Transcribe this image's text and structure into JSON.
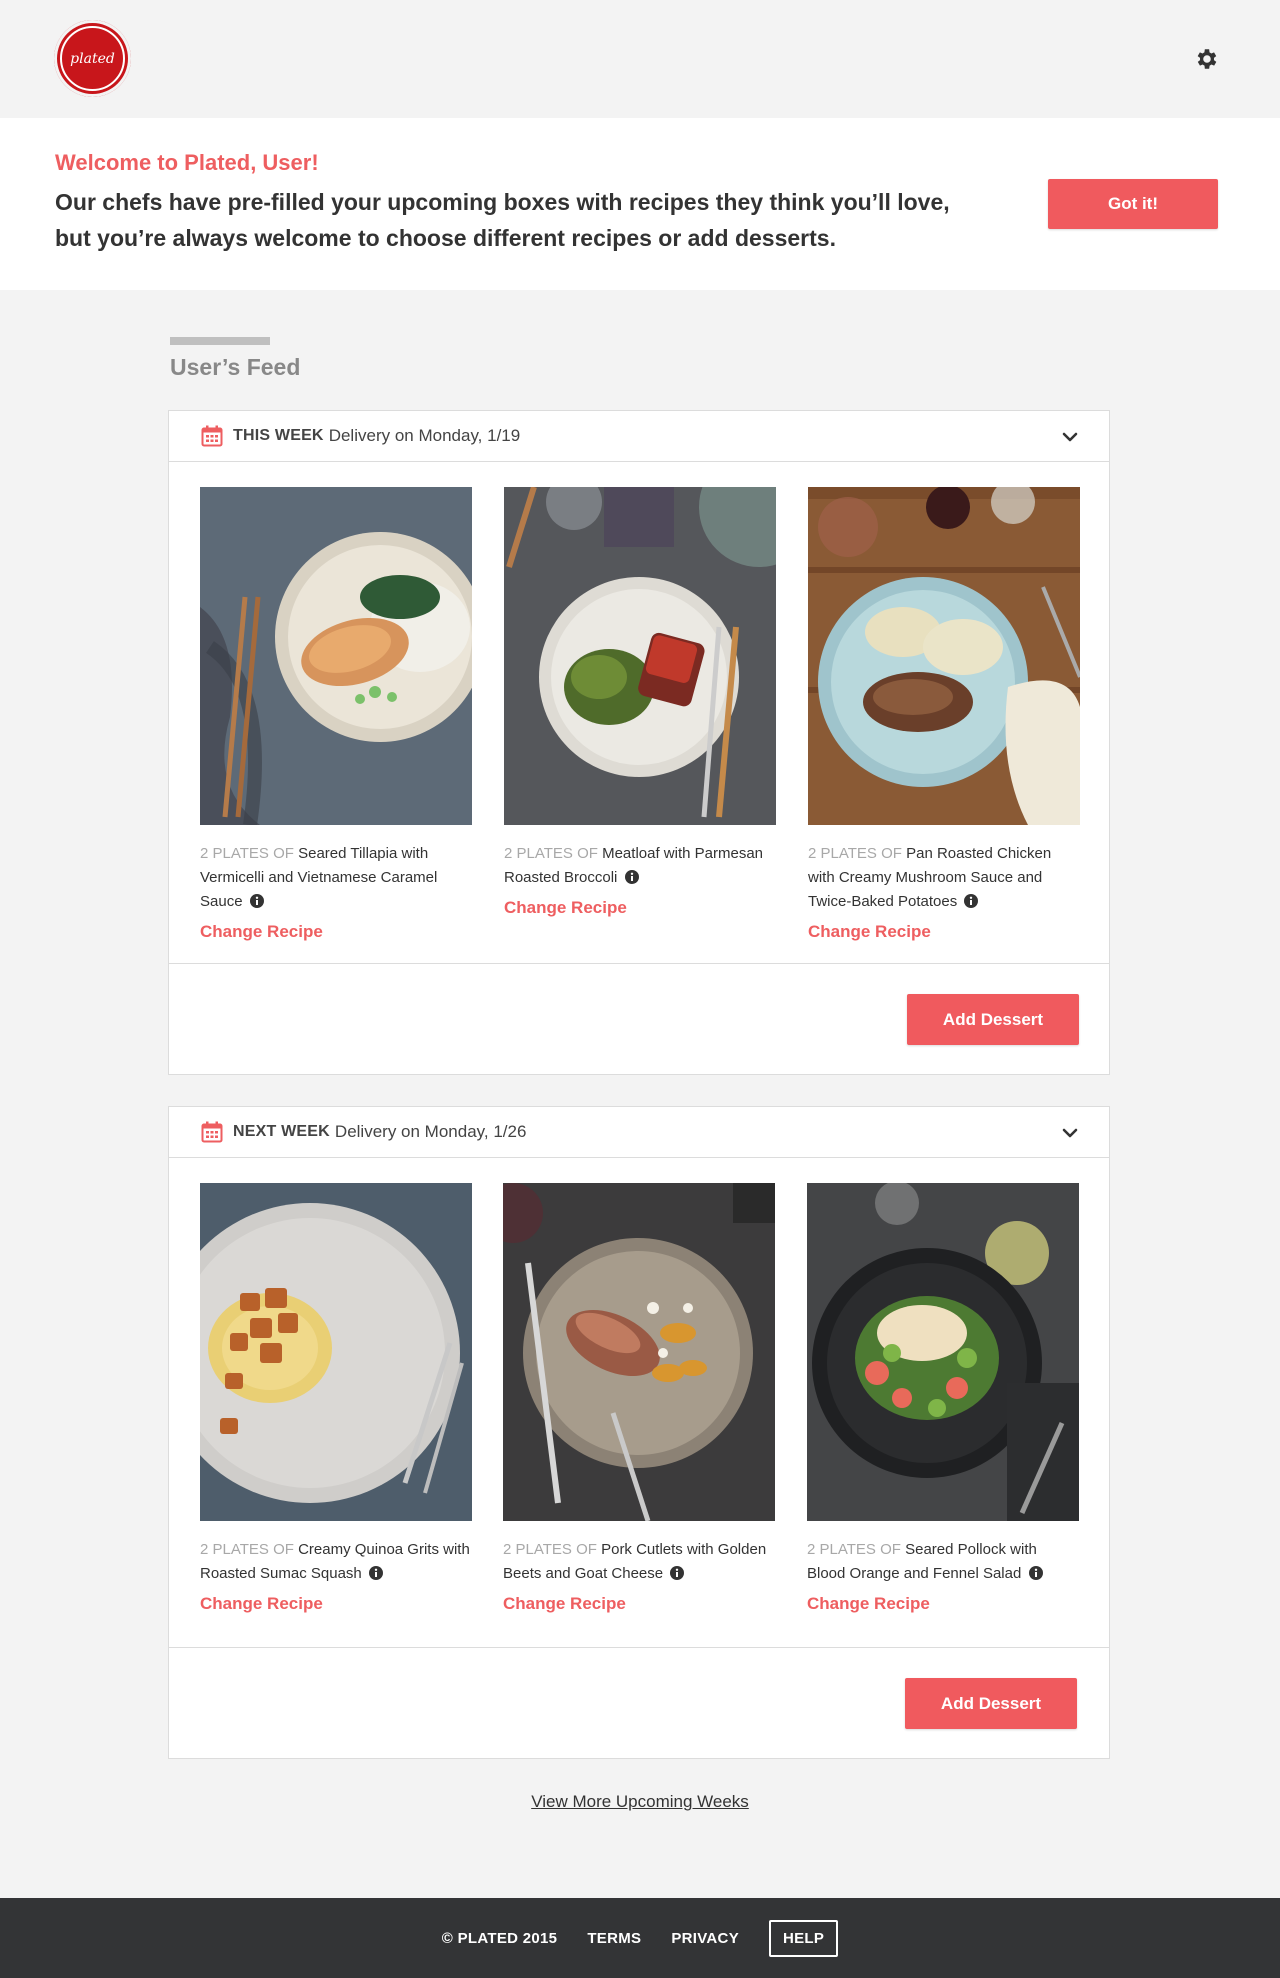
{
  "brand": {
    "logo_text": "plated"
  },
  "welcome": {
    "title": "Welcome to Plated, User!",
    "text_line1": "Our chefs have pre-filled your upcoming boxes with recipes they think you’ll love,",
    "text_line2": "but you’re always welcome to choose different recipes or add desserts.",
    "button": "Got it!"
  },
  "feed": {
    "title": "User’s Feed"
  },
  "weeks": [
    {
      "when": "THIS WEEK",
      "date": "Delivery on Monday, 1/19",
      "recipes": [
        {
          "plates": "2 PLATES OF",
          "name": "Seared Tillapia with Vermicelli and Vietnamese Caramel Sauce",
          "change": "Change Recipe"
        },
        {
          "plates": "2 PLATES OF",
          "name": "Meatloaf with Parmesan Roasted Broccoli",
          "change": "Change Recipe"
        },
        {
          "plates": "2 PLATES OF",
          "name": "Pan Roasted Chicken with Creamy Mushroom Sauce and Twice-Baked Potatoes",
          "change": "Change Recipe"
        }
      ],
      "add_dessert": "Add Dessert"
    },
    {
      "when": "NEXT WEEK",
      "date": "Delivery on Monday, 1/26",
      "recipes": [
        {
          "plates": "2 PLATES OF",
          "name": "Creamy Quinoa Grits with Roasted Sumac Squash",
          "change": "Change Recipe"
        },
        {
          "plates": "2 PLATES OF",
          "name": "Pork Cutlets with Golden Beets and Goat Cheese",
          "change": "Change Recipe"
        },
        {
          "plates": "2 PLATES OF",
          "name": "Seared Pollock with Blood Orange and Fennel Salad",
          "change": "Change Recipe"
        }
      ],
      "add_dessert": "Add Dessert"
    }
  ],
  "more_link": "View More Upcoming Weeks",
  "footer": {
    "copyright": "© PLATED 2015",
    "terms": "TERMS",
    "privacy": "PRIVACY",
    "help": "HELP"
  },
  "colors": {
    "accent": "#f05a5e",
    "brand_red": "#c8161b",
    "footer_bg": "#333436"
  }
}
